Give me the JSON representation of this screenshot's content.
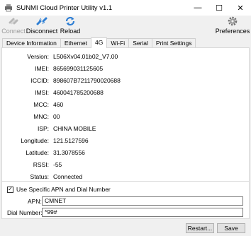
{
  "window": {
    "title": "SUNMI Cloud Printer Utility v1.1",
    "minimize": "—",
    "maximize": "☐",
    "close": "✕"
  },
  "toolbar": {
    "connect_label": "Connect",
    "disconnect_label": "Disconnect",
    "reload_label": "Reload",
    "preferences_label": "Preferences"
  },
  "tabs": [
    {
      "label": "Device Information"
    },
    {
      "label": "Ethernet"
    },
    {
      "label": "4G",
      "active": true
    },
    {
      "label": "Wi-Fi"
    },
    {
      "label": "Serial"
    },
    {
      "label": "Print Settings"
    }
  ],
  "info": [
    {
      "key": "Version:",
      "value": "L506Xv04.01b02_V7.00"
    },
    {
      "key": "IMEI:",
      "value": "865699031125605"
    },
    {
      "key": "ICCID:",
      "value": "898607B7211790020688"
    },
    {
      "key": "IMSI:",
      "value": "460041785200688"
    },
    {
      "key": "MCC:",
      "value": "460"
    },
    {
      "key": "MNC:",
      "value": "00"
    },
    {
      "key": "ISP:",
      "value": "CHINA MOBILE"
    },
    {
      "key": "Longitude:",
      "value": "121.5127596"
    },
    {
      "key": "Latitude:",
      "value": "31.3078556"
    },
    {
      "key": "RSSI:",
      "value": "-55"
    },
    {
      "key": "Status:",
      "value": "Connected"
    }
  ],
  "apn": {
    "checkbox_label": "Use Specific APN and Dial Number",
    "checkbox_mark": "✓",
    "checked": true,
    "apn_label": "APN:",
    "apn_value": "CMNET",
    "dial_label": "Dial Number:",
    "dial_value": "*99#"
  },
  "buttons": {
    "restart_label": "Restart...",
    "save_label": "Save"
  },
  "colors": {
    "accent_blue": "#2f7fd4",
    "window_bg": "#f0f0f0"
  }
}
